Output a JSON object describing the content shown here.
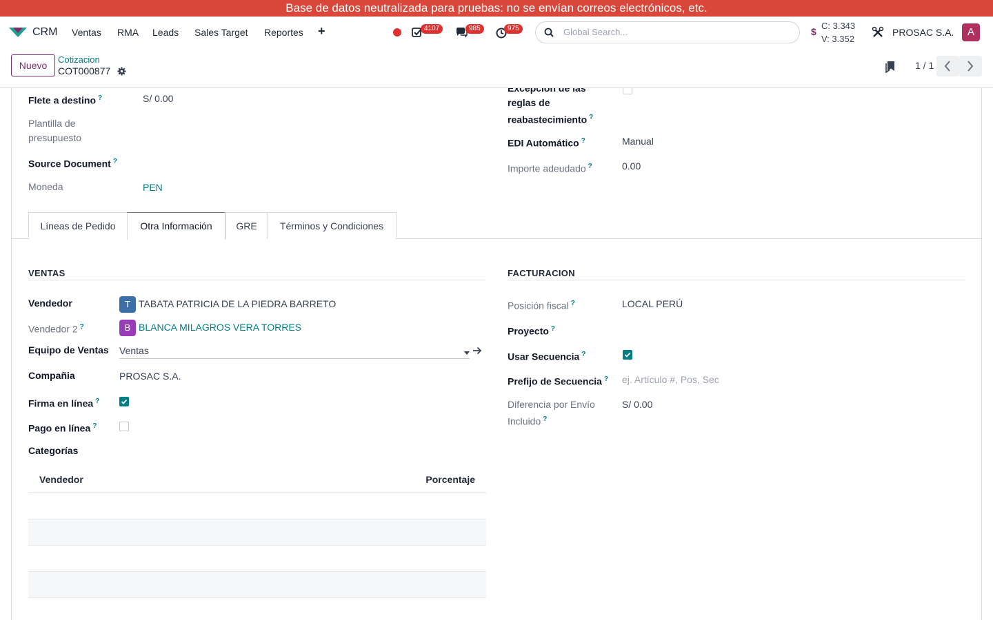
{
  "banner": "Base de datos neutralizada para pruebas: no se envían correos electrónicos, etc.",
  "navbar": {
    "app_name": "CRM",
    "menus": [
      "Ventas",
      "RMA",
      "Leads",
      "Sales Target",
      "Reportes"
    ],
    "plus": "+",
    "badges": {
      "activities": "4107",
      "messages": "985",
      "timers": "975"
    },
    "search_placeholder": "Global Search...",
    "currency_symbol": "$",
    "rate_buy": "C: 3.343",
    "rate_sell": "V: 3.352",
    "company": "PROSAC S.A.",
    "avatar_initial": "A"
  },
  "control": {
    "new_button": "Nuevo",
    "breadcrumb_parent": "Cotizacion",
    "breadcrumb_current": "COT000877",
    "pager": "1 / 1"
  },
  "top_fields": {
    "flete_label": "Flete a destino",
    "flete_value": "S/ 0.00",
    "plantilla_label_1": "Plantilla de",
    "plantilla_label_2": "presupuesto",
    "source_label": "Source Document",
    "moneda_label": "Moneda",
    "moneda_value": "PEN",
    "excepcion_label_1": "Excepción de las",
    "excepcion_label_2": "reglas de",
    "excepcion_label_3": "reabastecimiento",
    "edi_label": "EDI Automático",
    "edi_value": "Manual",
    "importe_label": "Importe adeudado",
    "importe_value": "0.00"
  },
  "tabs": [
    "Líneas de Pedido",
    "Otra Información",
    "GRE",
    "Términos y Condiciones"
  ],
  "ventas": {
    "title": "VENTAS",
    "vendedor_label": "Vendedor",
    "vendedor_initial": "T",
    "vendedor_value": "TABATA PATRICIA DE LA PIEDRA BARRETO",
    "vendedor2_label": "Vendedor 2",
    "vendedor2_initial": "B",
    "vendedor2_value": "BLANCA MILAGROS VERA TORRES",
    "equipo_label": "Equipo de Ventas",
    "equipo_value": "Ventas",
    "compania_label": "Compañia",
    "compania_value": "PROSAC S.A.",
    "firma_label": "Firma en línea",
    "firma_checked": true,
    "pago_label": "Pago en línea",
    "pago_checked": false,
    "categorias_label": "Categorías",
    "table_headers": [
      "Vendedor",
      "Porcentaje"
    ]
  },
  "facturacion": {
    "title": "FACTURACION",
    "posicion_label": "Posición fiscal",
    "posicion_value": "LOCAL PERÚ",
    "proyecto_label": "Proyecto",
    "usar_secuencia_label": "Usar Secuencia",
    "usar_secuencia_checked": true,
    "prefijo_label": "Prefijo de Secuencia",
    "prefijo_placeholder": "ej. Artículo #, Pos, Sec",
    "diferencia_label_1": "Diferencia por Envío",
    "diferencia_label_2": "Incluido",
    "diferencia_value": "S/ 0.00"
  },
  "help_mark": "?",
  "colors": {
    "banner": "#d9473b",
    "accent": "#017e84",
    "brand": "#7c2d6e",
    "badge": "#e03131"
  }
}
